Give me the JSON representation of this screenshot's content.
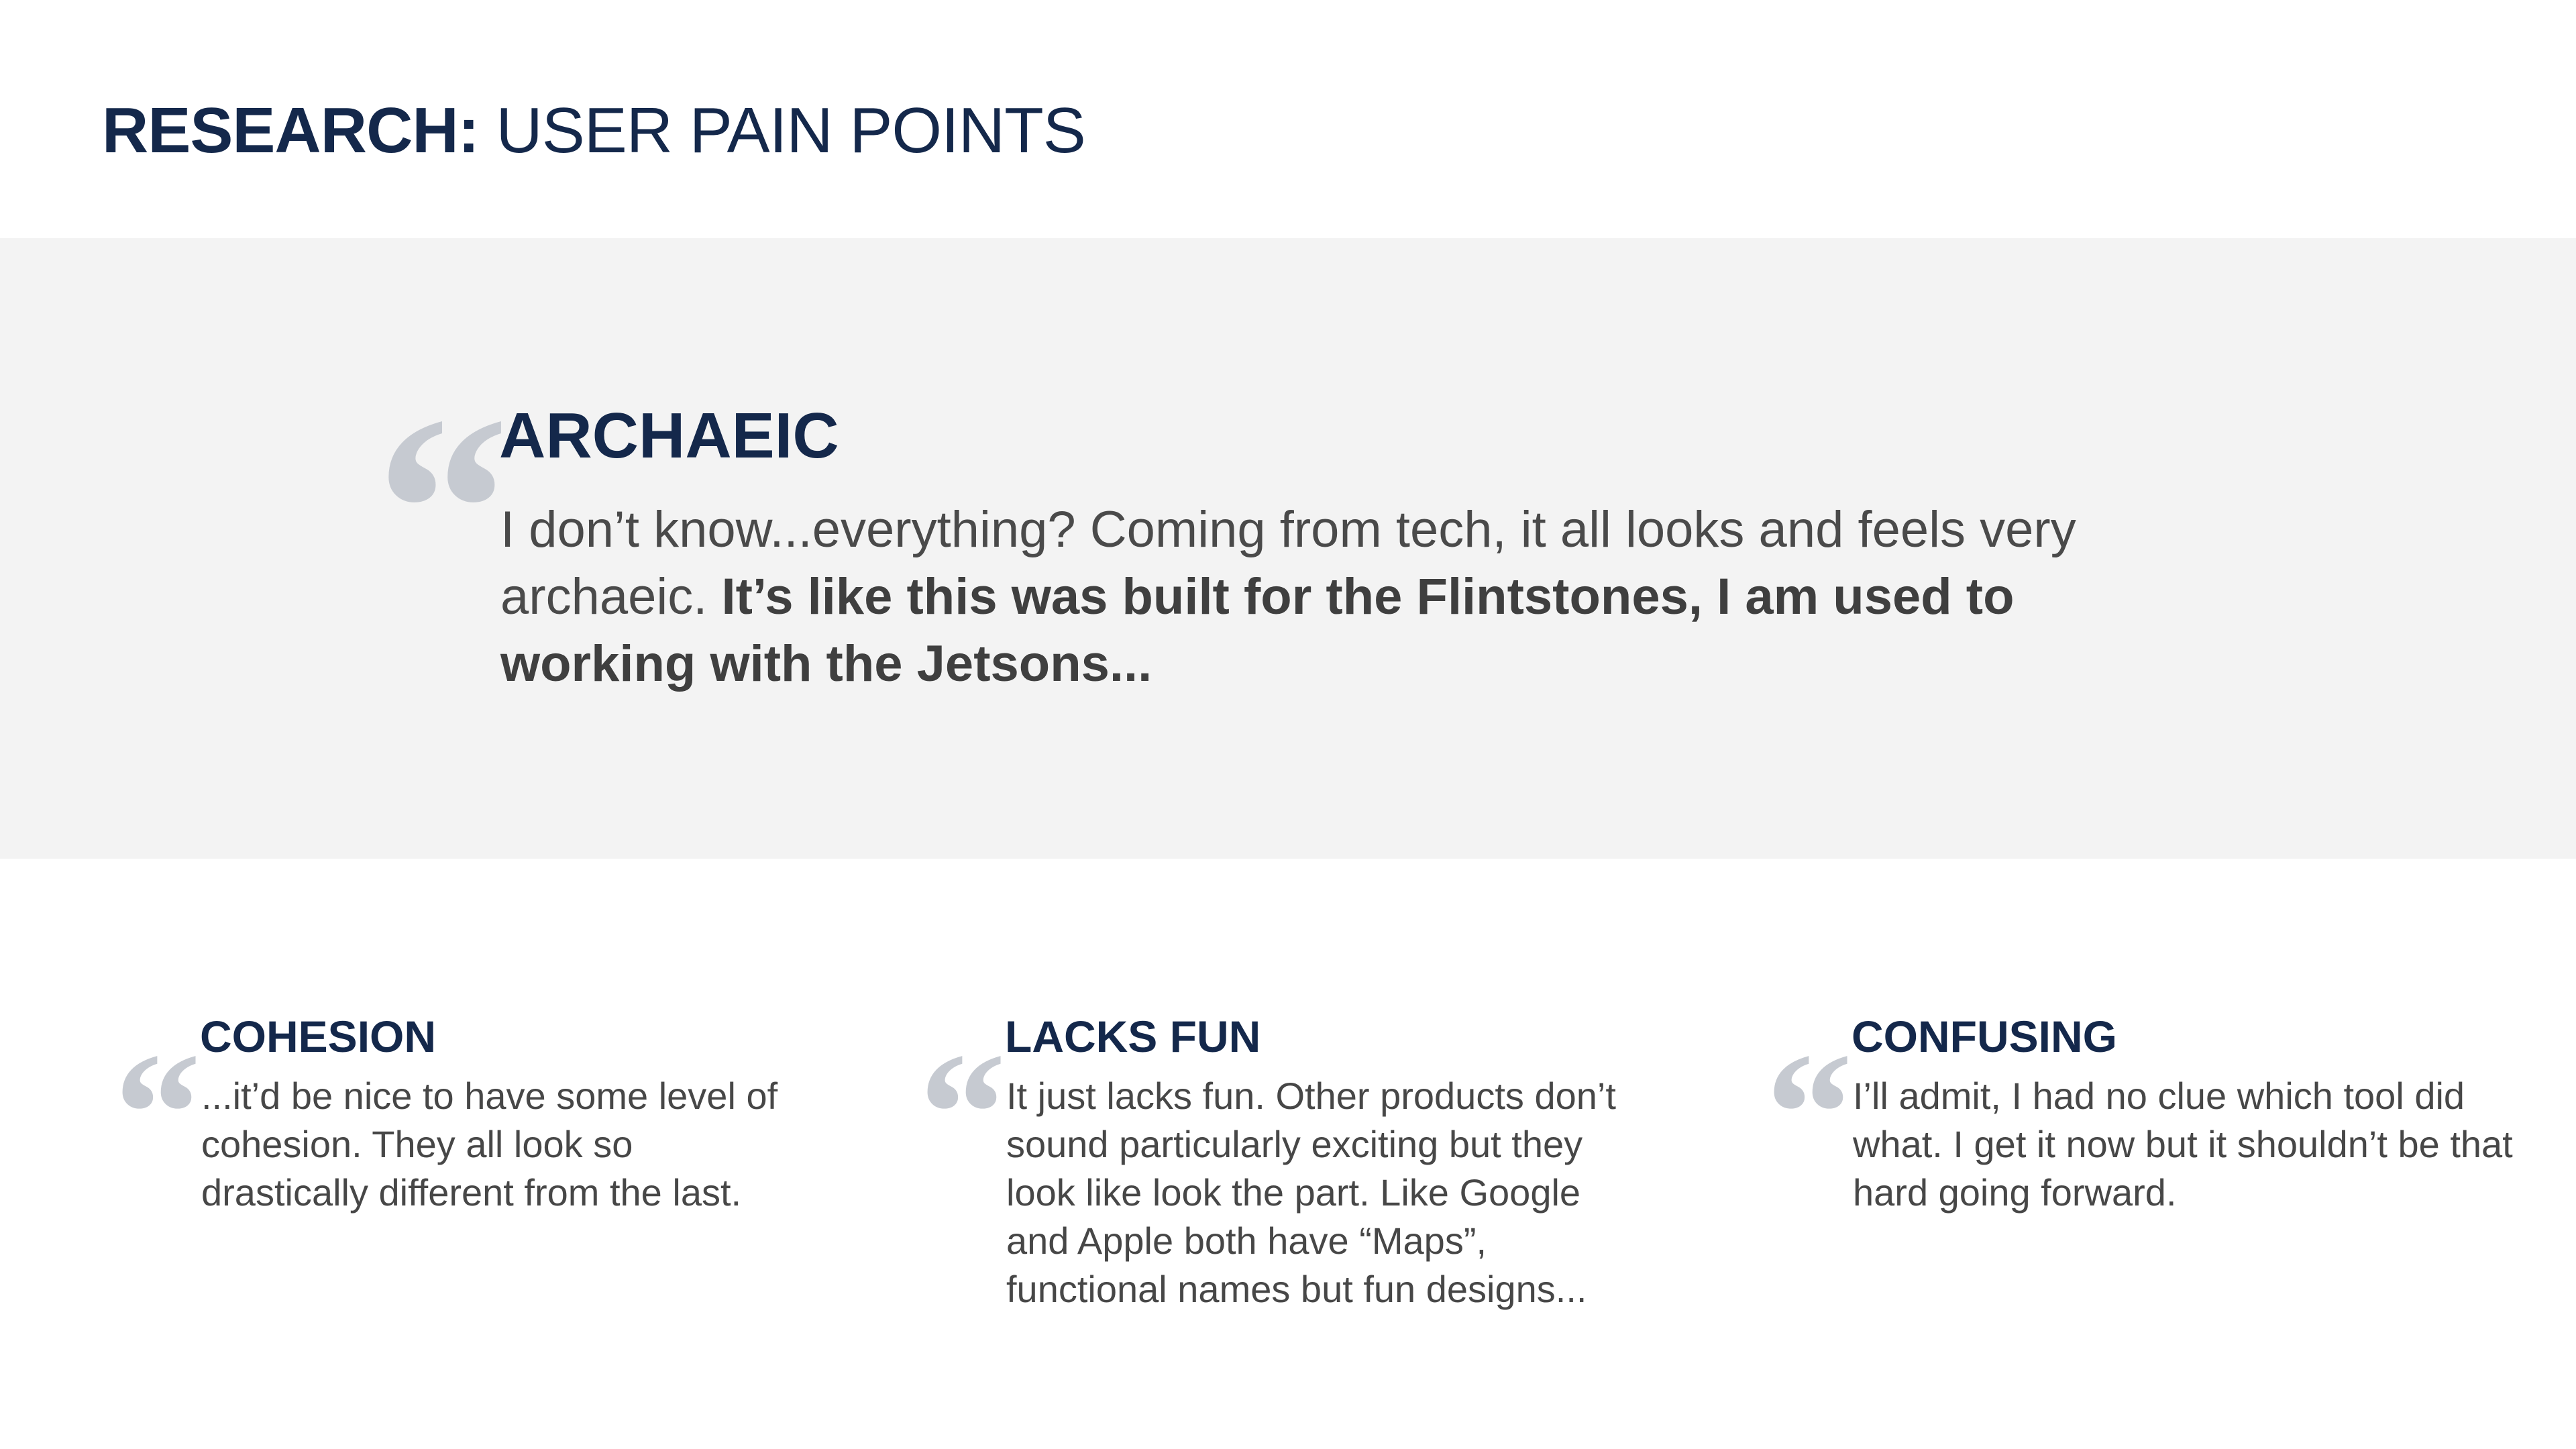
{
  "header": {
    "title_strong": "RESEARCH:",
    "title_rest": " USER PAIN POINTS"
  },
  "feature": {
    "quote_mark": "“",
    "title": "ARCHAEIC",
    "body_plain": "I don’t know...everything? Coming from tech, it all looks and feels very archaeic. ",
    "body_bold": "It’s like this was built for the Flintstones, I am used to working with the Jetsons..."
  },
  "cards": [
    {
      "quote_mark": "“",
      "title": "COHESION",
      "body": "...it’d be nice to have some level of cohesion. They all look so drastically different from the last."
    },
    {
      "quote_mark": "“",
      "title": "LACKS FUN",
      "body": "It just lacks fun. Other products don’t sound particularly exciting but they look like look the part. Like Google and Apple both have “Maps”, functional names but fun designs..."
    },
    {
      "quote_mark": "“",
      "title": "CONFUSING",
      "body": "I’ll admit, I had no clue which tool did what. I get it now but it shouldn’t be that hard going forward."
    }
  ],
  "colors": {
    "navy": "#14284b",
    "band_gray": "#f3f3f3",
    "quote_gray": "#c6cad1",
    "body_text": "#4a4a4a"
  }
}
